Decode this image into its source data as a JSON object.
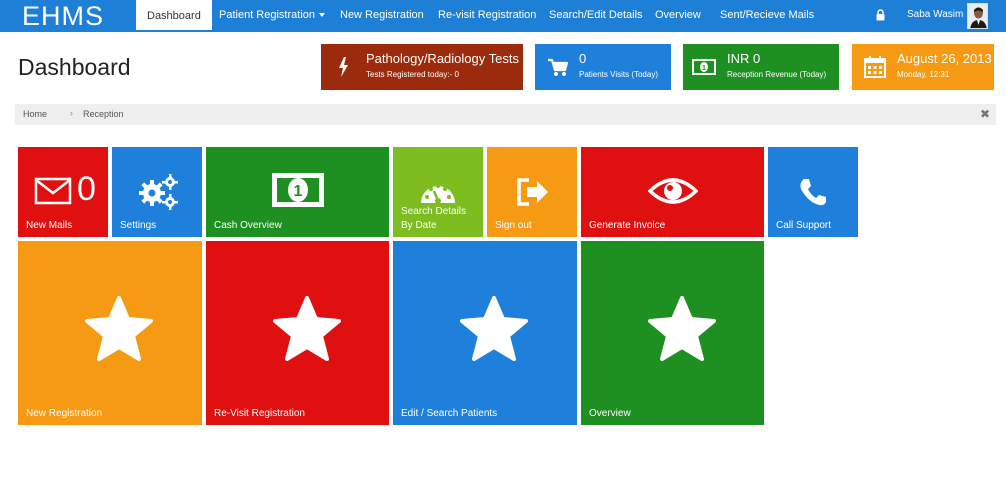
{
  "brand": "EHMS",
  "nav": {
    "dashboard": "Dashboard",
    "patient_registration": "Patient Registration",
    "new_registration": "New Registration",
    "revisit_registration": "Re-visit Registration",
    "search_edit": "Search/Edit Details",
    "overview": "Overview",
    "mails": "Sent/Recieve Mails"
  },
  "user": {
    "name": "Saba Wasim"
  },
  "page_title": "Dashboard",
  "stats": {
    "tests": {
      "title": "Pathology/Radiology Tests",
      "sub": "Tests Registered today:- 0"
    },
    "visits": {
      "value": "0",
      "sub": "Patients Visits (Today)"
    },
    "revenue": {
      "value": "INR 0",
      "sub": "Reception Revenue (Today)"
    },
    "date": {
      "value": "August 26, 2013",
      "sub": "Monday, 12:31"
    }
  },
  "breadcrumb": {
    "home": "Home",
    "current": "Reception"
  },
  "tiles": {
    "mails_count": "0",
    "new_mails": "New Mails",
    "settings": "Settings",
    "cash_overview": "Cash Overview",
    "search_by_date_1": "Search Details",
    "search_by_date_2": "By Date",
    "sign_out": "Sign out",
    "generate_invoice": "Generate Invoice",
    "call_support": "Call Support",
    "new_registration": "New Registration",
    "revisit_registration": "Re-Visit Registration",
    "edit_search_patients": "Edit / Search Patients",
    "overview": "Overview"
  },
  "colors": {
    "nav": "#1e7fd6",
    "red": "#e01010",
    "blue": "#1f80dc",
    "green": "#1e8f21",
    "lime": "#7dbd1f",
    "orange": "#f59a12",
    "brown": "#9b2b0c"
  }
}
